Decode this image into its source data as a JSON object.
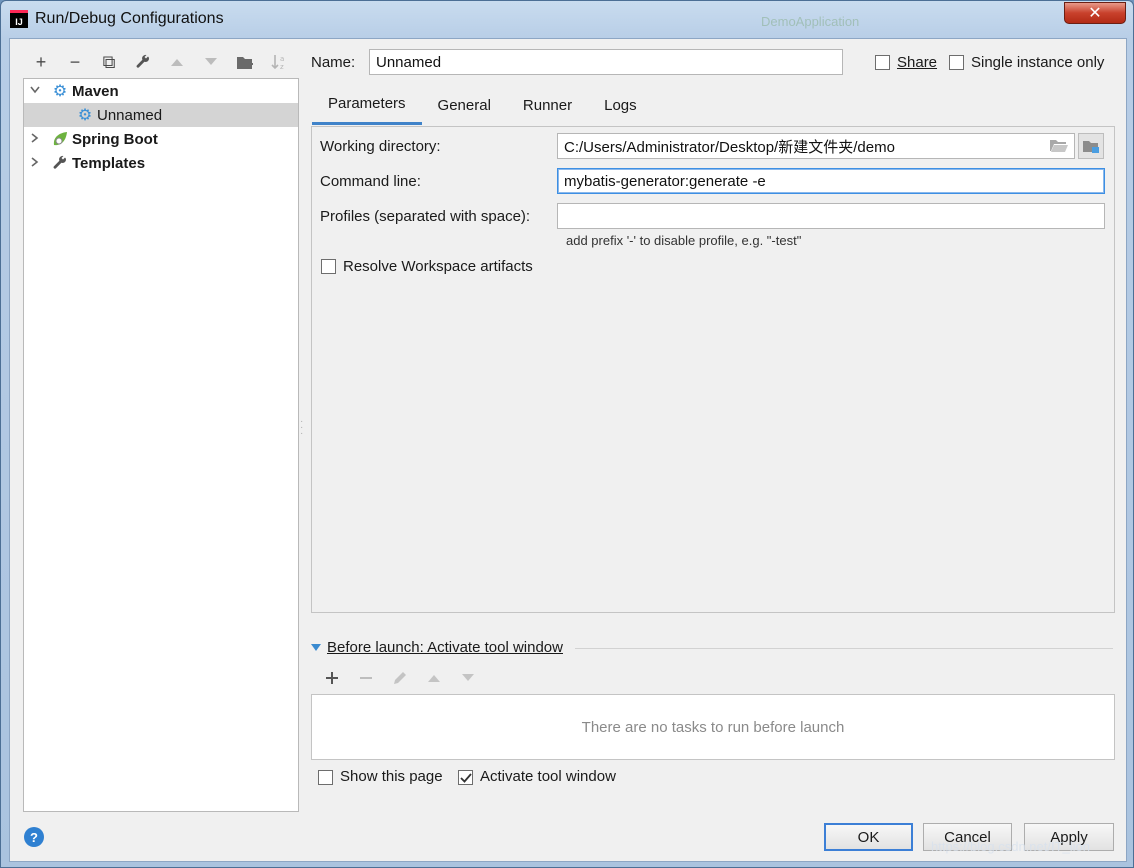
{
  "window": {
    "title": "Run/Debug Configurations",
    "background_hint": "DemoApplication",
    "close_glyph": "✕"
  },
  "toolbar": {
    "items": [
      {
        "icon": "plus-icon",
        "glyph": "+"
      },
      {
        "icon": "minus-icon",
        "glyph": "−"
      },
      {
        "icon": "copy-icon",
        "glyph": "⧉"
      },
      {
        "icon": "wrench-icon",
        "glyph": "🔧"
      },
      {
        "icon": "arrow-up-icon",
        "glyph": "▲"
      },
      {
        "icon": "arrow-down-icon",
        "glyph": "▼"
      },
      {
        "icon": "new-folder-icon",
        "glyph": "📁"
      },
      {
        "icon": "sort-icon",
        "glyph": "↓ᵃ"
      }
    ]
  },
  "tree": {
    "items": [
      {
        "label": "Maven",
        "icon": "gear-icon",
        "expanded": true
      },
      {
        "label": "Unnamed",
        "icon": "gear-icon",
        "selected": true
      },
      {
        "label": "Spring Boot",
        "icon": "spring-leaf-icon",
        "expanded": false
      },
      {
        "label": "Templates",
        "icon": "wrench-icon",
        "expanded": false
      }
    ]
  },
  "name_field": {
    "label": "Name:",
    "value": "Unnamed"
  },
  "share": {
    "label": "Share",
    "checked": false
  },
  "single_instance": {
    "label": "Single instance only",
    "checked": false
  },
  "tabs": [
    {
      "label": "Parameters",
      "active": true
    },
    {
      "label": "General"
    },
    {
      "label": "Runner"
    },
    {
      "label": "Logs"
    }
  ],
  "parameters": {
    "working_directory": {
      "label": "Working directory:",
      "value": "C:/Users/Administrator/Desktop/新建文件夹/demo"
    },
    "command_line": {
      "label": "Command line:",
      "value": "mybatis-generator:generate -e"
    },
    "profiles": {
      "label": "Profiles (separated with space):",
      "value": "",
      "hint": "add prefix '-' to disable profile, e.g. \"-test\""
    },
    "resolve_workspace": {
      "label": "Resolve Workspace artifacts",
      "checked": false
    }
  },
  "before_launch": {
    "title": "Before launch: Activate tool window",
    "empty_text": "There are no tasks to run before launch",
    "show_page": {
      "label": "Show this page",
      "checked": false
    },
    "activate_tool_window": {
      "label": "Activate tool window",
      "checked": true
    }
  },
  "buttons": {
    "ok": "OK",
    "cancel": "Cancel",
    "apply": "Apply",
    "help": "?"
  },
  "watermark": "https://blog.csdn.net/IT_lion"
}
